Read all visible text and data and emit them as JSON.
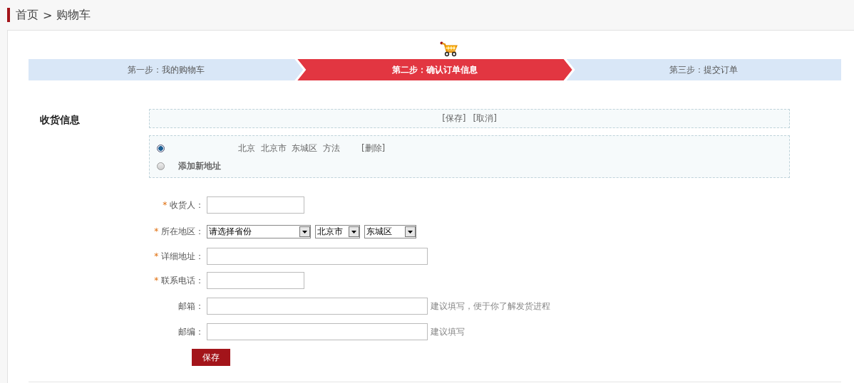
{
  "breadcrumb": {
    "home": "首页",
    "separator": ">",
    "current": "购物车"
  },
  "steps": [
    {
      "label": "第一步：我的购物车",
      "selected": false
    },
    {
      "label": "第二步：确认订单信息",
      "selected": true
    },
    {
      "label": "第三步：提交订单",
      "selected": false
    }
  ],
  "section_title": "收货信息",
  "edit_actions": [
    "[保存]",
    "[取消]"
  ],
  "addresses": [
    {
      "kind": "saved",
      "text": "北京  北京市  东城区  方法",
      "action": "[删除]",
      "selected": true
    },
    {
      "kind": "new",
      "text": "添加新地址",
      "selected": false
    }
  ],
  "form": [
    {
      "kind": "text",
      "marker": "*",
      "label": "收货人："
    },
    {
      "kind": "region",
      "marker": "*",
      "label": "所在地区：",
      "selects": [
        {
          "value": "请选择省份"
        },
        {
          "value": "北京市"
        },
        {
          "value": "东城区"
        }
      ]
    },
    {
      "kind": "text",
      "marker": "*",
      "label": "详细地址："
    },
    {
      "kind": "text",
      "marker": "*",
      "label": "联系电话："
    },
    {
      "kind": "text",
      "label": "邮箱：",
      "hint": "建议填写，便于你了解发货进程"
    },
    {
      "kind": "text",
      "label": "邮编：",
      "hint": "建议填写"
    }
  ],
  "save_button": "保存"
}
